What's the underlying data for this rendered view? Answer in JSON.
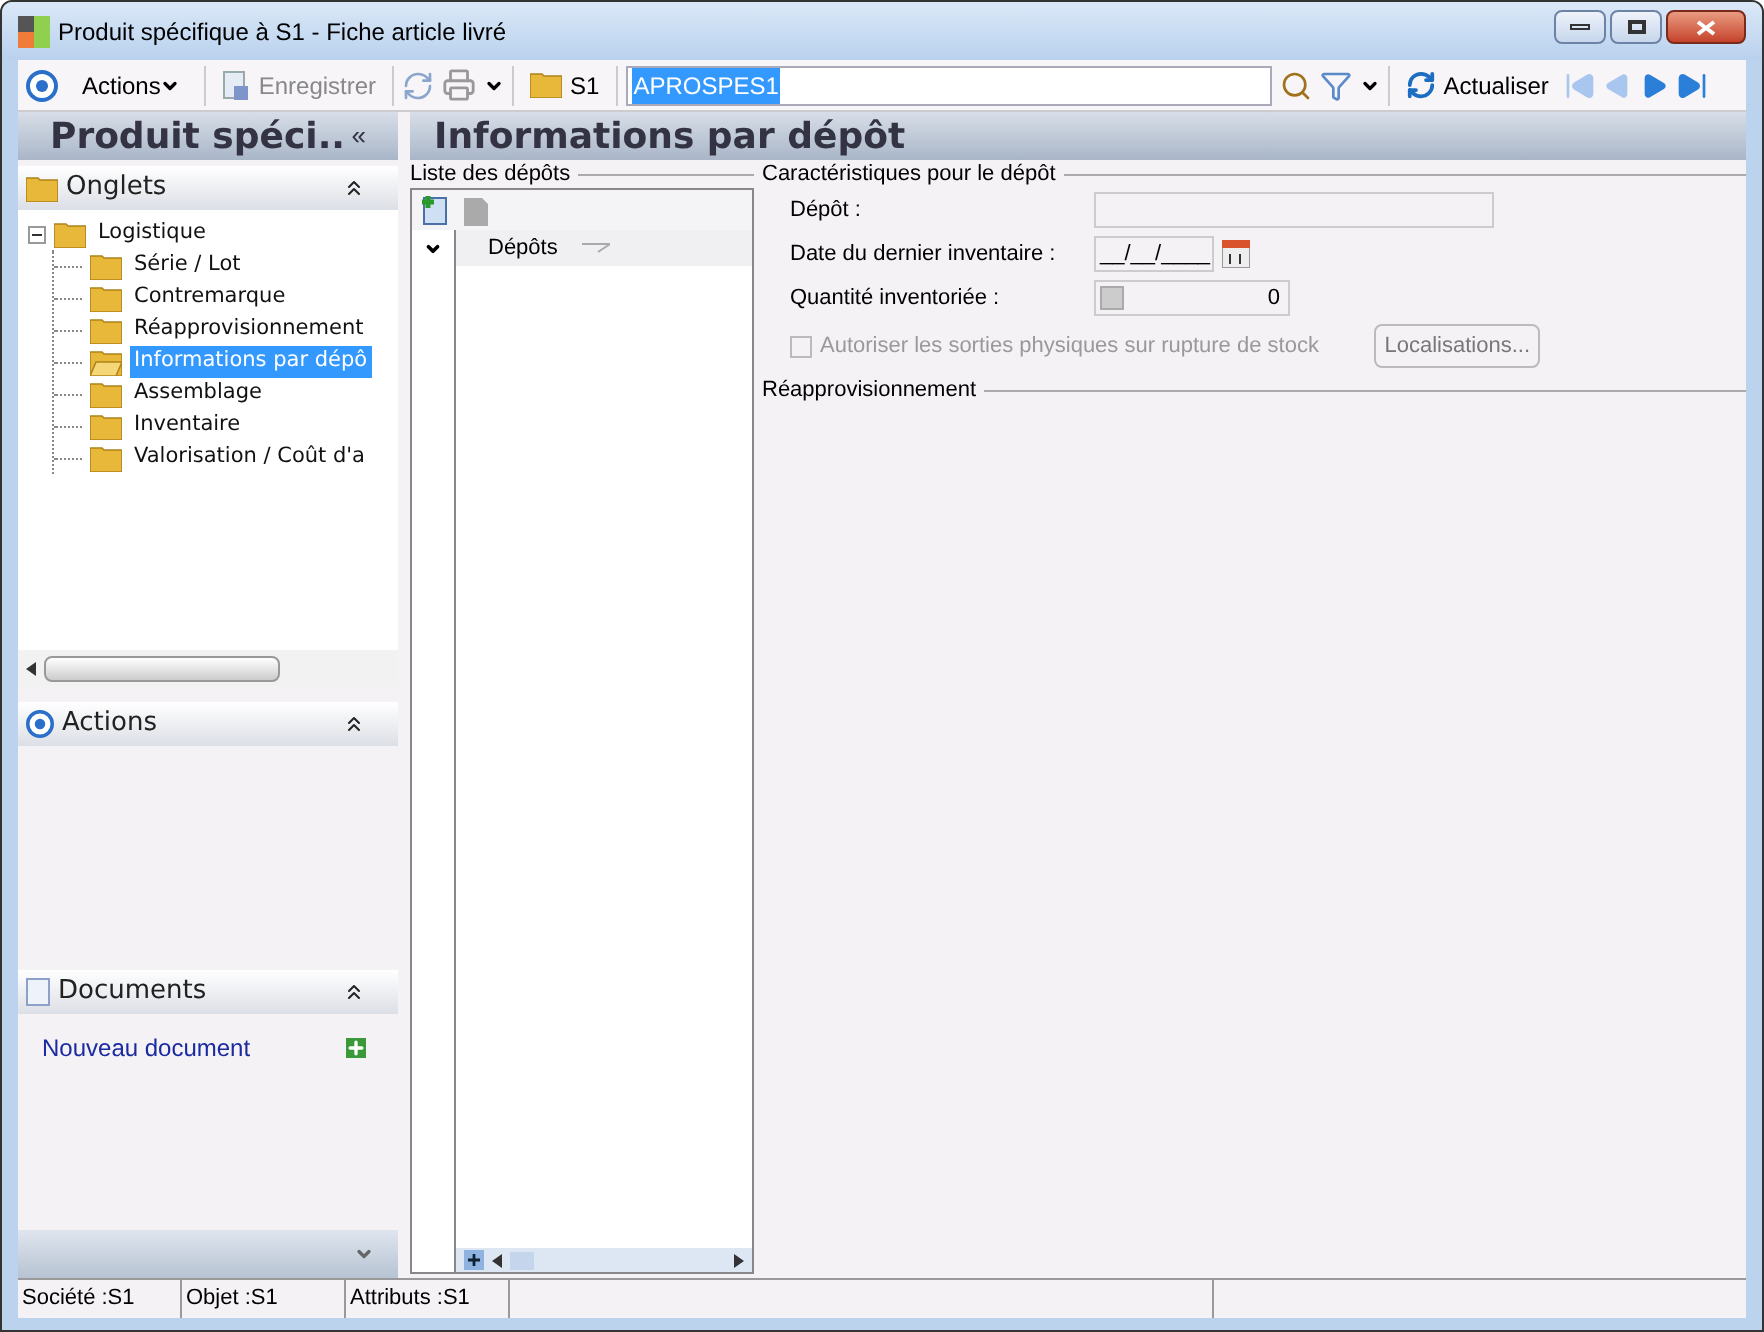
{
  "window": {
    "title": "Produit spécifique à S1 -  Fiche article livré"
  },
  "toolbar": {
    "actions_label": "Actions",
    "save_label": "Enregistrer",
    "save_disabled": true,
    "folder_label": "S1",
    "search_value": "APROSPES1",
    "refresh_label": "Actualiser"
  },
  "left_panel": {
    "title": "Produit spéci..",
    "collapse_glyph": "«",
    "tabs_section": {
      "title": "Onglets",
      "expanded": true,
      "tree": [
        {
          "label": "Logistique",
          "expanded": true,
          "selected": false,
          "children": [
            {
              "label": "Série / Lot",
              "selected": false
            },
            {
              "label": "Contremarque",
              "selected": false
            },
            {
              "label": "Réapprovisionnement",
              "selected": false
            },
            {
              "label": "Informations par dépô",
              "selected": true
            },
            {
              "label": "Assemblage",
              "selected": false
            },
            {
              "label": "Inventaire",
              "selected": false
            },
            {
              "label": "Valorisation / Coût d'a",
              "selected": false
            }
          ]
        }
      ]
    },
    "actions_section": {
      "title": "Actions",
      "expanded": true
    },
    "documents_section": {
      "title": "Documents",
      "expanded": true,
      "link": "Nouveau document"
    }
  },
  "main": {
    "title": "Informations par dépôt",
    "list": {
      "title": "Liste des dépôts",
      "column": "Dépôts"
    },
    "details": {
      "title": "Caractéristiques pour le dépôt",
      "fields": [
        {
          "kind": "text",
          "label": "Dépôt :"
        },
        {
          "kind": "date",
          "label": "Date du dernier inventaire :",
          "value": "__/__/____"
        },
        {
          "kind": "number",
          "label": "Quantité inventoriée :",
          "value": "0"
        }
      ],
      "checkbox": {
        "label": "Autoriser les sorties physiques sur rupture de stock",
        "checked": false,
        "disabled": true
      },
      "button": "Localisations..."
    },
    "section_2": {
      "title": "Réapprovisionnement"
    }
  },
  "status_bar": [
    "Société :S1",
    "Objet :S1",
    "Attributs :S1"
  ]
}
